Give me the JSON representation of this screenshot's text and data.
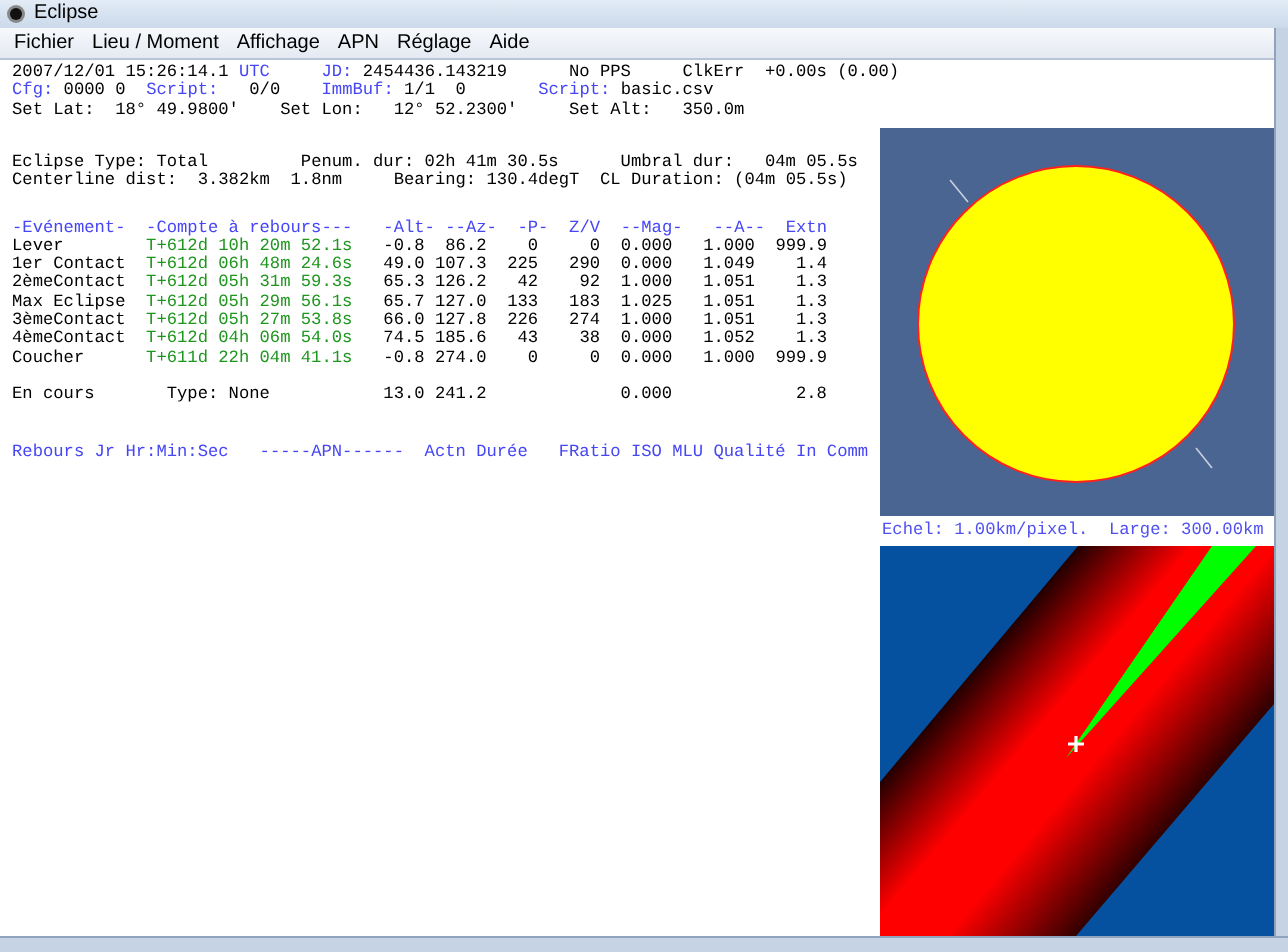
{
  "window": {
    "title": "Eclipse"
  },
  "menu": [
    "Fichier",
    "Lieu / Moment",
    "Affichage",
    "APN",
    "Réglage",
    "Aide"
  ],
  "status_lines": [
    [
      {
        "text": "2007/12/01 15:26:14.1",
        "kind": "value"
      },
      {
        "text": "UTC",
        "kind": "label"
      },
      {
        "text": "JD:",
        "kind": "label"
      },
      {
        "text": "2454436.143219",
        "kind": "value"
      },
      {
        "text": "No PPS",
        "kind": "value"
      },
      {
        "text": "ClkErr",
        "kind": "value"
      },
      {
        "text": "+0.00s (0.00)",
        "kind": "value"
      }
    ],
    [
      {
        "text": "Cfg:",
        "kind": "label"
      },
      {
        "text": "0000 0",
        "kind": "value"
      },
      {
        "text": "Script:",
        "kind": "label"
      },
      {
        "text": "0/0",
        "kind": "value"
      },
      {
        "text": "ImmBuf:",
        "kind": "label"
      },
      {
        "text": "1/1  0",
        "kind": "value"
      },
      {
        "text": "Script:",
        "kind": "label"
      },
      {
        "text": "basic.csv",
        "kind": "value"
      }
    ],
    [
      {
        "text": "Set Lat:",
        "kind": "value"
      },
      {
        "text": "18° 49.9800'",
        "kind": "value"
      },
      {
        "text": "Set Lon:",
        "kind": "value"
      },
      {
        "text": "12° 52.2300'",
        "kind": "value"
      },
      {
        "text": "Set Alt:",
        "kind": "value"
      },
      {
        "text": "350.0m",
        "kind": "value"
      }
    ]
  ],
  "summary_lines": [
    [
      "Eclipse Type: Total",
      "Penum. dur: 02h 41m 30.5s",
      "Umbral dur:",
      "04m 05.5s"
    ],
    [
      "Centerline dist:",
      "3.382km",
      "1.8nm",
      "Bearing:",
      "130.4degT",
      "CL Duration:",
      "(04m 05.5s)"
    ]
  ],
  "events": {
    "columns": [
      "-Evénement-",
      "-Compte à rebours---",
      "-Alt-",
      "--Az-",
      "-P-",
      "Z/V",
      "--Mag-",
      "--A--",
      "Extn"
    ],
    "rows": [
      [
        "Lever",
        "T+612d 10h 20m 52.1s",
        "-0.8",
        "86.2",
        "0",
        "0",
        "0.000",
        "1.000",
        "999.9"
      ],
      [
        "1er Contact",
        "T+612d 06h 48m 24.6s",
        "49.0",
        "107.3",
        "225",
        "290",
        "0.000",
        "1.049",
        "1.4"
      ],
      [
        "2èmeContact",
        "T+612d 05h 31m 59.3s",
        "65.3",
        "126.2",
        "42",
        "92",
        "1.000",
        "1.051",
        "1.3"
      ],
      [
        "Max Eclipse",
        "T+612d 05h 29m 56.1s",
        "65.7",
        "127.0",
        "133",
        "183",
        "1.025",
        "1.051",
        "1.3"
      ],
      [
        "3èmeContact",
        "T+612d 05h 27m 53.8s",
        "66.0",
        "127.8",
        "226",
        "274",
        "1.000",
        "1.051",
        "1.3"
      ],
      [
        "4èmeContact",
        "T+612d 04h 06m 54.0s",
        "74.5",
        "185.6",
        "43",
        "38",
        "0.000",
        "1.052",
        "1.3"
      ],
      [
        "Coucher",
        "T+611d 22h 04m 41.1s",
        "-0.8",
        "274.0",
        "0",
        "0",
        "0.000",
        "1.000",
        "999.9"
      ]
    ]
  },
  "current": {
    "label": "En cours",
    "type": "Type: None",
    "alt": "13.0",
    "az": "241.2",
    "mag": "0.000",
    "extn": "2.8"
  },
  "sequence_header": [
    "Rebours Jr Hr:Min:Sec",
    "-----APN------",
    "Actn Durée",
    "FRatio ISO MLU Qualité In Comm"
  ],
  "scale_label": "Echel: 1.00km/pixel.  Large: 300.00km"
}
